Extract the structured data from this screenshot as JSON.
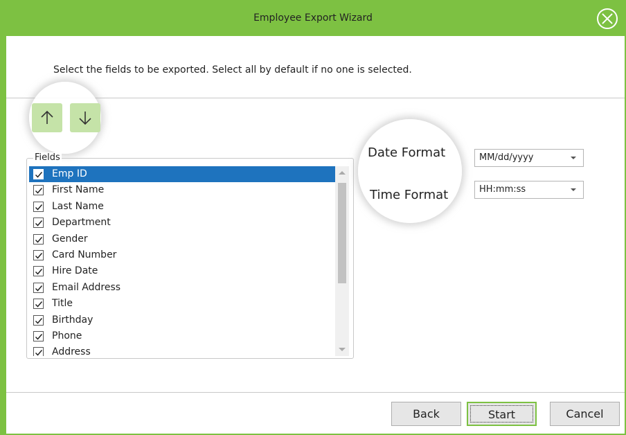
{
  "window": {
    "title": "Employee Export Wizard"
  },
  "instruction": "Select the fields to be exported. Select all by default if no one is selected.",
  "fields": {
    "legend": "Fields",
    "items": [
      {
        "label": "Emp ID",
        "checked": true,
        "selected": true
      },
      {
        "label": "First Name",
        "checked": true
      },
      {
        "label": "Last Name",
        "checked": true
      },
      {
        "label": "Department",
        "checked": true
      },
      {
        "label": "Gender",
        "checked": true
      },
      {
        "label": "Card Number",
        "checked": true
      },
      {
        "label": "Hire Date",
        "checked": true
      },
      {
        "label": "Email Address",
        "checked": true
      },
      {
        "label": "Title",
        "checked": true
      },
      {
        "label": "Birthday",
        "checked": true
      },
      {
        "label": "Phone",
        "checked": true
      },
      {
        "label": "Address",
        "checked": true
      }
    ]
  },
  "formats": {
    "date_label": "Date Format",
    "date_value": "MM/dd/yyyy",
    "time_label": "Time Format",
    "time_value": "HH:mm:ss"
  },
  "buttons": {
    "back": "Back",
    "start": "Start",
    "cancel": "Cancel"
  },
  "colors": {
    "accent": "#7dc142",
    "selection": "#1e73be",
    "arrow_button": "#c5e3a8"
  },
  "icons": {
    "close": "close-icon",
    "move_up": "arrow-up-icon",
    "move_down": "arrow-down-icon",
    "check": "checkmark-icon"
  }
}
